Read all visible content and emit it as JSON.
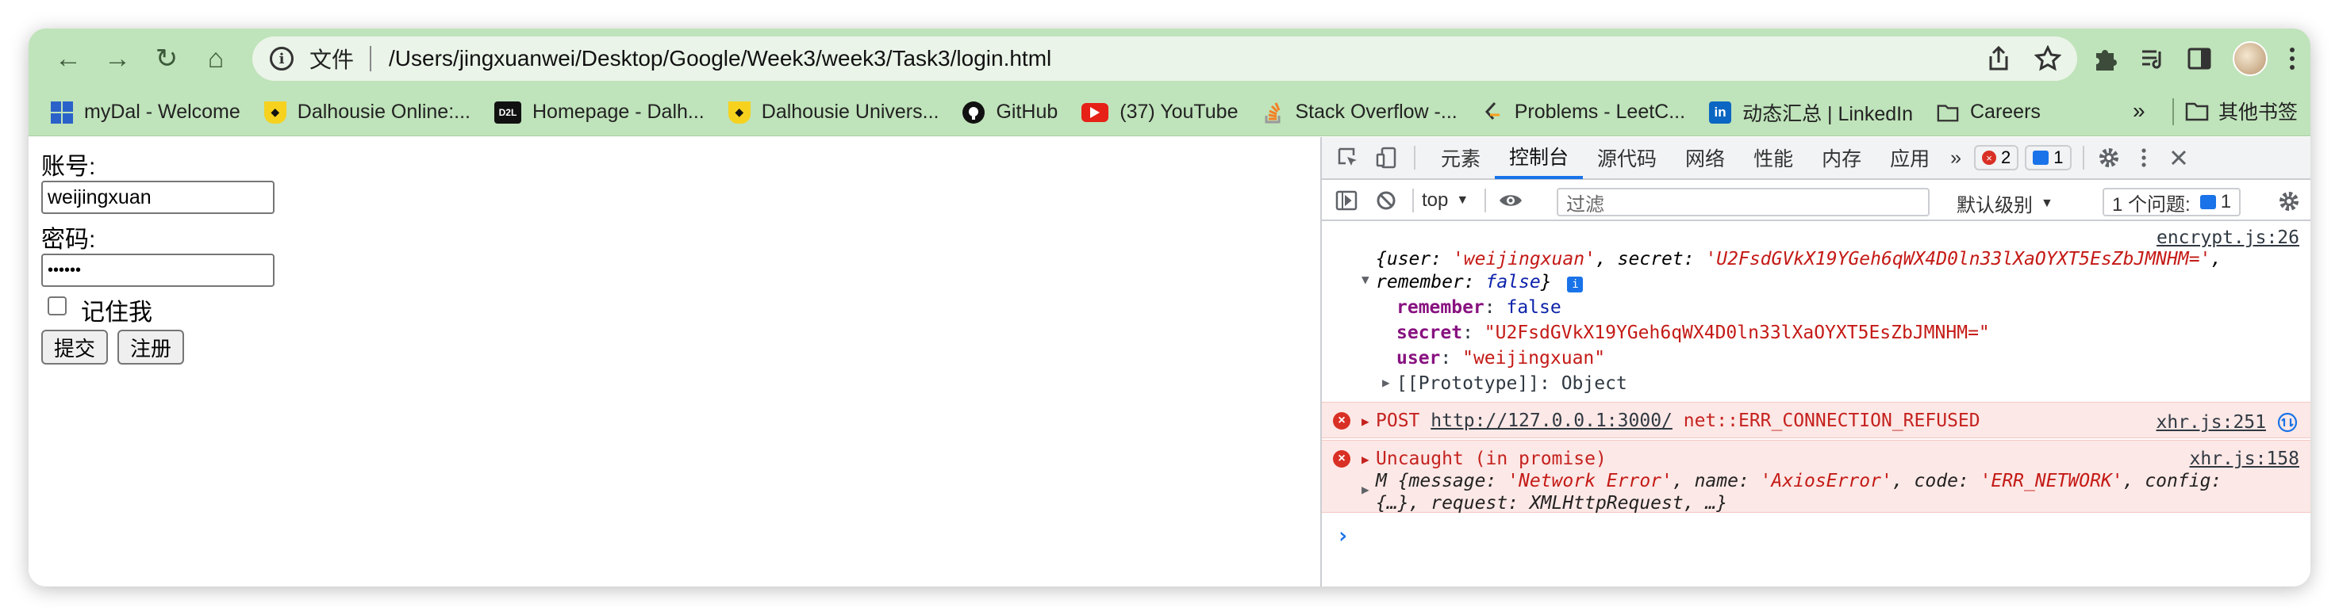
{
  "toolbar": {
    "back": "←",
    "forward": "→",
    "reload": "↻",
    "home": "⌂",
    "omnibox_label": "文件",
    "url": "/Users/jingxuanwei/Desktop/Google/Week3/week3/Task3/login.html"
  },
  "bookmarks": [
    {
      "label": "myDal - Welcome",
      "icon": "windows-icon"
    },
    {
      "label": "Dalhousie Online:...",
      "icon": "dal-crest-icon"
    },
    {
      "label": "Homepage - Dalh...",
      "icon": "d2l-icon",
      "icon_text": "D2L"
    },
    {
      "label": "Dalhousie Univers...",
      "icon": "dal-crest-icon"
    },
    {
      "label": "GitHub",
      "icon": "github-icon"
    },
    {
      "label": "(37) YouTube",
      "icon": "youtube-icon"
    },
    {
      "label": "Stack Overflow -...",
      "icon": "stackoverflow-icon"
    },
    {
      "label": "Problems - LeetC...",
      "icon": "leetcode-icon"
    },
    {
      "label": "动态汇总 | LinkedIn",
      "icon": "linkedin-icon",
      "icon_text": "in"
    },
    {
      "label": "Careers",
      "icon": "folder-icon"
    }
  ],
  "bookmarks_more": "»",
  "other_bookmarks": "其他书签",
  "form": {
    "account_label": "账号:",
    "account_value": "weijingxuan",
    "password_label": "密码:",
    "password_value": "••••••",
    "remember_label": "记住我",
    "submit_label": "提交",
    "register_label": "注册"
  },
  "devtools": {
    "tabs": [
      "元素",
      "控制台",
      "源代码",
      "网络",
      "性能",
      "内存",
      "应用"
    ],
    "active_tab": "控制台",
    "more": "»",
    "error_count": "2",
    "message_count": "1",
    "context": "top",
    "filter_placeholder": "过滤",
    "log_level": "默认级别",
    "issues_label": "1 个问题:",
    "issues_count": "1",
    "console": {
      "log_source": "encrypt.js:26",
      "obj_summary_1_pre": "{user: ",
      "obj_user": "'weijingxuan'",
      "obj_mid": ", secret: ",
      "obj_secret": "'U2FsdGVkX19YGeh6qWX4D0ln33lXaOYXT5EsZbJMNHM='",
      "obj_end1": ",",
      "obj_summary_2_pre": "remember: ",
      "obj_remember": "false",
      "obj_end2": "}",
      "props": [
        {
          "key": "remember",
          "value": "false",
          "type": "kw"
        },
        {
          "key": "secret",
          "value": "\"U2FsdGVkX19YGeh6qWX4D0ln33lXaOYXT5EsZbJMNHM=\"",
          "type": "str"
        },
        {
          "key": "user",
          "value": "\"weijingxuan\"",
          "type": "str"
        }
      ],
      "prototype": "[[Prototype]]: Object",
      "err1_method": "POST ",
      "err1_url": "http://127.0.0.1:3000/",
      "err1_msg": " net::ERR_CONNECTION_REFUSED",
      "err1_source": "xhr.js:251",
      "err2_title": "Uncaught (in promise)",
      "err2_source": "xhr.js:158",
      "err2_line1_pre": "M {message: ",
      "err2_message": "'Network Error'",
      "err2_name_pre": ", name: ",
      "err2_name": "'AxiosError'",
      "err2_code_pre": ", code: ",
      "err2_code": "'ERR_NETWORK'",
      "err2_config_pre": ", config:",
      "err2_line2": "{…}, request: XMLHttpRequest, …}",
      "prompt": "›"
    }
  }
}
